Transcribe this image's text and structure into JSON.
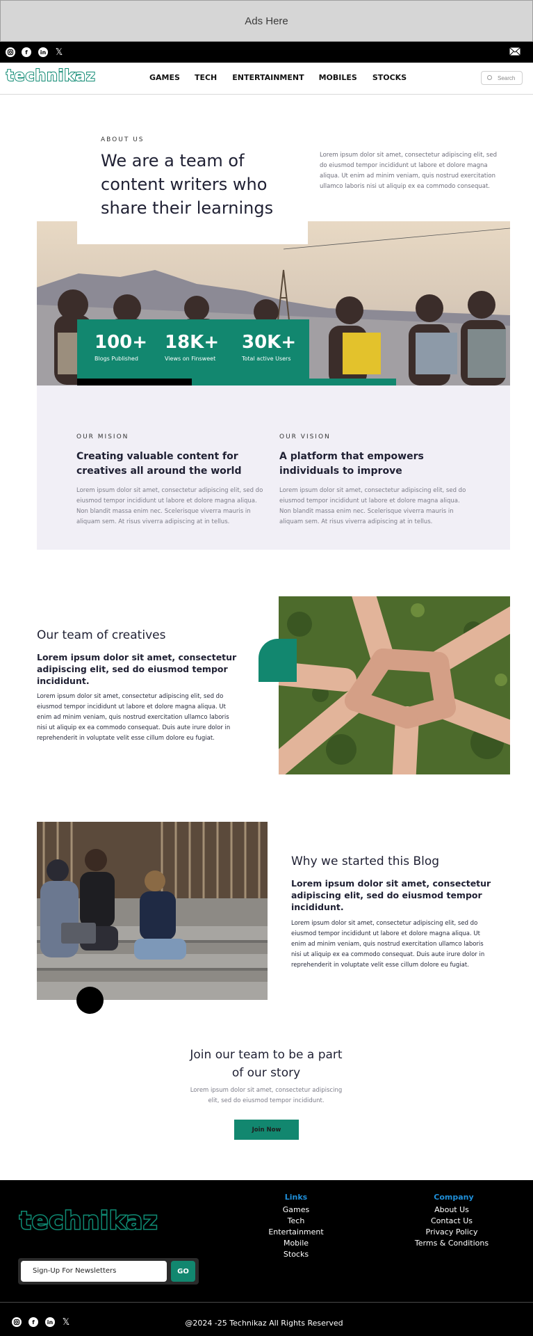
{
  "ad": {
    "label": "Ads Here"
  },
  "social": {
    "icons": [
      "instagram-icon",
      "facebook-icon",
      "linkedin-icon",
      "x-icon"
    ],
    "mail_icon": "mail-icon"
  },
  "brand": {
    "name": "technikaz",
    "accent": "#12876f"
  },
  "nav": {
    "items": [
      "GAMES",
      "TECH",
      "ENTERTAINMENT",
      "MOBILES",
      "STOCKS"
    ],
    "search_placeholder": "Search"
  },
  "about": {
    "eyebrow": "ABOUT US",
    "heading": [
      "We are a team of",
      "content writers who",
      "share their learnings"
    ],
    "intro": "Lorem ipsum dolor sit amet, consectetur adipiscing elit, sed do eiusmod tempor incididunt ut labore et dolore magna aliqua. Ut enim ad minim veniam, quis nostrud exercitation ullamco laboris nisi ut aliquip ex ea commodo consequat."
  },
  "stats": [
    {
      "value": "100+",
      "label": "Blogs Published"
    },
    {
      "value": "18K+",
      "label": "Views on Finsweet"
    },
    {
      "value": "30K+",
      "label": "Total active Users"
    }
  ],
  "mission": {
    "eyebrow": "OUR MISION",
    "title": [
      "Creating valuable content for",
      "creatives all around the world"
    ],
    "body": "Lorem ipsum dolor sit amet, consectetur adipiscing elit, sed do eiusmod tempor incididunt ut labore et dolore magna aliqua. Non blandit massa enim nec. Scelerisque viverra mauris in aliquam sem. At risus viverra adipiscing at in tellus."
  },
  "vision": {
    "eyebrow": "OUR VISION",
    "title": [
      "A platform that empowers",
      "individuals to improve"
    ],
    "body": "Lorem ipsum dolor sit amet, consectetur adipiscing elit, sed do eiusmod tempor incididunt ut labore et dolore magna aliqua. Non blandit massa enim nec. Scelerisque viverra mauris in aliquam sem. At risus viverra adipiscing at in tellus."
  },
  "team": {
    "title": "Our team of creatives",
    "subtitle": [
      "Lorem ipsum dolor sit amet, consectetur",
      "adipiscing elit, sed do eiusmod tempor",
      "incididunt."
    ],
    "body": "Lorem ipsum dolor sit amet, consectetur adipiscing elit, sed do eiusmod tempor incididunt ut labore et dolore magna aliqua. Ut enim ad minim veniam, quis nostrud exercitation ullamco laboris nisi ut aliquip ex ea commodo consequat. Duis aute irure dolor in reprehenderit in voluptate velit esse cillum dolore eu fugiat."
  },
  "why": {
    "title": "Why we started this Blog",
    "subtitle": [
      "Lorem ipsum dolor sit amet, consectetur",
      "adipiscing elit, sed do eiusmod tempor",
      "incididunt."
    ],
    "body": "Lorem ipsum dolor sit amet, consectetur adipiscing elit, sed do eiusmod tempor incididunt ut labore et dolore magna aliqua. Ut enim ad minim veniam, quis nostrud exercitation ullamco laboris nisi ut aliquip ex ea commodo consequat. Duis aute irure dolor in reprehenderit in voluptate velit esse cillum dolore eu fugiat."
  },
  "join": {
    "title": [
      "Join our team to be a part",
      "of our story"
    ],
    "body": [
      "Lorem ipsum dolor sit amet, consectetur adipiscing",
      "elit, sed do eiusmod tempor incididunt."
    ],
    "button": "Join Now"
  },
  "footer": {
    "links_heading": "Links",
    "links": [
      "Games",
      "Tech",
      "Entertainment",
      "Mobile",
      "Stocks"
    ],
    "company_heading": "Company",
    "company": [
      "About Us",
      "Contact Us",
      "Privacy Policy",
      "Terms & Conditions"
    ],
    "newsletter_placeholder": "Sign-Up For Newsletters",
    "newsletter_button": "GO",
    "copyright": "@2024 -25 Technikaz All Rights Reserved",
    "link_color": "#1f8fd9"
  }
}
